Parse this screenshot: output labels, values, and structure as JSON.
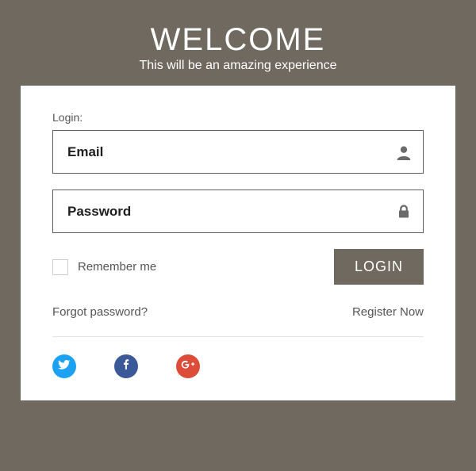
{
  "header": {
    "title": "WELCOME",
    "subtitle": "This will be an amazing experience"
  },
  "form": {
    "section_label": "Login:",
    "email_placeholder": "Email",
    "password_placeholder": "Password",
    "remember_label": "Remember me",
    "login_button": "LOGIN"
  },
  "links": {
    "forgot": "Forgot password?",
    "register": "Register Now"
  },
  "icons": {
    "user": "user-icon",
    "lock": "lock-icon",
    "twitter": "twitter-icon",
    "facebook": "facebook-icon",
    "googleplus": "google-plus-icon"
  },
  "colors": {
    "bg": "#70695f",
    "twitter": "#1da1f2",
    "facebook": "#3b5998",
    "googleplus": "#dd4b39"
  }
}
